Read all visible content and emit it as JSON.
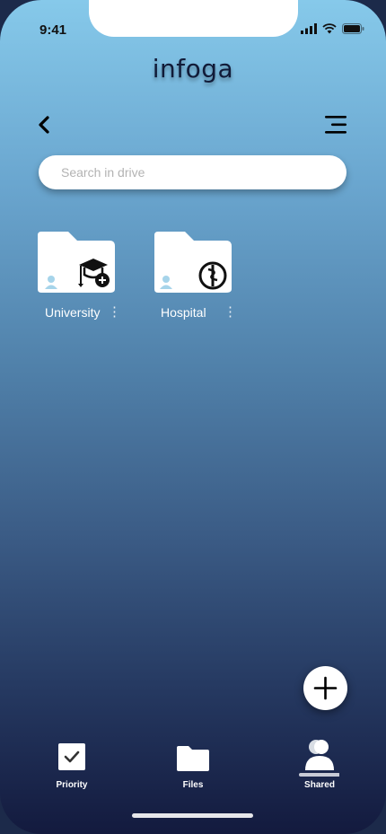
{
  "status_bar": {
    "time": "9:41",
    "icons": [
      "signal-icon",
      "wifi-icon",
      "battery-icon"
    ]
  },
  "app": {
    "logo": "infoga"
  },
  "header": {
    "back_icon": "chevron-left-icon",
    "menu_icon": "menu-icon"
  },
  "search": {
    "placeholder": "Search in drive",
    "value": ""
  },
  "folders": [
    {
      "label": "University",
      "icon": "graduation-cap-plus-icon",
      "shared_icon": "person-icon",
      "more_icon": "kebab-icon"
    },
    {
      "label": "Hospital",
      "icon": "medical-caduceus-icon",
      "shared_icon": "person-icon",
      "more_icon": "kebab-icon"
    }
  ],
  "fab": {
    "icon": "plus-icon"
  },
  "bottom_nav": {
    "items": [
      {
        "label": "Priority",
        "icon": "checkbox-icon"
      },
      {
        "label": "Files",
        "icon": "folder-icon"
      },
      {
        "label": "Shared",
        "icon": "shared-users-icon",
        "active": true
      }
    ]
  },
  "colors": {
    "gradient_top": "#86c9ea",
    "gradient_bottom": "#131a3e",
    "logo": "#111b38"
  }
}
